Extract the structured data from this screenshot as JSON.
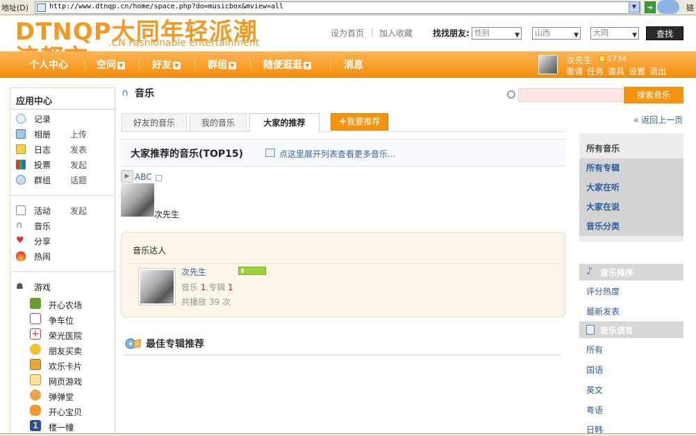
{
  "browser": {
    "address_label": "地址(D)",
    "url": "http://www.dtnqp.cn/home/space.php?do=musicbox&mview=all",
    "links_label": "链"
  },
  "header": {
    "logo_text": "DTNQP大同年轻派潮流都市",
    "logo_tagline": ".CN Fashionable entertainment",
    "link_home": "设为首页",
    "link_sep": "|",
    "link_fav": "加入收藏",
    "find_label": "找找朋友:",
    "gender_value": "性别",
    "province_value": "山西",
    "city_value": "大同",
    "find_button": "查找"
  },
  "nav": {
    "items": [
      "个人中心",
      "空间",
      "好友",
      "群组",
      "随便逛逛",
      "消息"
    ],
    "username": "次先生",
    "points": "1734",
    "sub_links": [
      "邀请",
      "任务",
      "道具",
      "设置",
      "退出"
    ]
  },
  "sidebar": {
    "title": "应用中心",
    "apps": [
      {
        "label": "记录",
        "action": ""
      },
      {
        "label": "相册",
        "action": "上传"
      },
      {
        "label": "日志",
        "action": "发表"
      },
      {
        "label": "投票",
        "action": "发起"
      },
      {
        "label": "群组",
        "action": "话题"
      }
    ],
    "apps2": [
      {
        "label": "活动",
        "action": "发起"
      },
      {
        "label": "音乐",
        "action": ""
      },
      {
        "label": "分享",
        "action": ""
      },
      {
        "label": "热闹",
        "action": ""
      }
    ],
    "games_title": "游戏",
    "games": [
      "开心农场",
      "争车位",
      "荣光医院",
      "朋友买卖",
      "欢乐卡片",
      "网页游戏",
      "弹弹堂",
      "开心宝贝",
      "楼一幢"
    ]
  },
  "music": {
    "title": "音乐",
    "search_button": "搜索音乐",
    "tabs": [
      "好友的音乐",
      "我的音乐",
      "大家的推荐"
    ],
    "recommend_button": "我要推荐",
    "back_link": "« 返回上一页",
    "top15_title": "大家推荐的音乐(TOP15)",
    "top15_link": "点这里展开列表查看更多音乐...",
    "song_name": "ABC",
    "song_user": "次先生",
    "talent_title": "音乐达人",
    "talent_name": "次先生",
    "talent_music_label": "音乐",
    "talent_music_count": "1",
    "talent_album_label": ",专辑",
    "talent_album_count": "1",
    "talent_plays": "共播放 39 次",
    "best_albums_title": "最佳专辑推荐"
  },
  "right_panel": {
    "all_music": "所有音乐",
    "items": [
      "所有专辑",
      "大家在听",
      "大家在说",
      "音乐分类"
    ],
    "ranking_title": "音乐排序",
    "ranking_links": [
      "评分热度",
      "最新发表"
    ],
    "language_title": "音乐语言",
    "language_links": [
      "所有",
      "国语",
      "英文",
      "粤语",
      "日韩"
    ]
  },
  "colors": {
    "brand_orange": "#f5930f",
    "link_blue": "#2a5d9f"
  }
}
